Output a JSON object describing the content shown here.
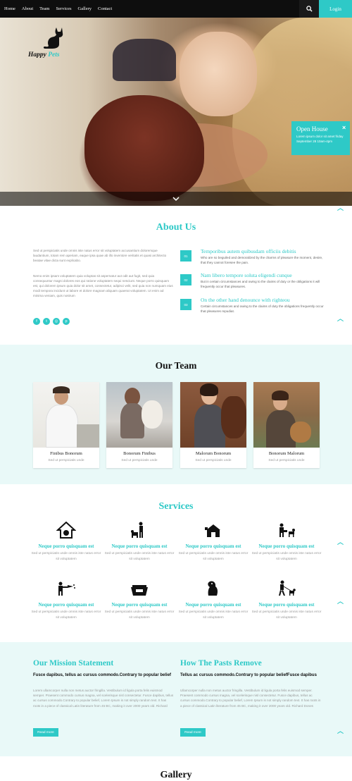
{
  "nav": {
    "items": [
      "Home",
      "About",
      "Team",
      "Services",
      "Gallery",
      "Contact"
    ],
    "search_icon": "search-icon",
    "login_label": "Login"
  },
  "brand": {
    "name_part1": "Happy",
    "name_part2": "Pets"
  },
  "hero": {
    "popup": {
      "title": "Open House",
      "close": "×",
      "text": "Lorem ipsum dolor sit amet friday September 28 10am-4pm"
    }
  },
  "about": {
    "title": "About Us",
    "para1": "Sed ut perspiciatis unde omnis iste natus error sit voluptatem accusantium doloremque laudantium, totam rem aperiam, eaque ipsa quae ab illo inventore veritatis et quasi architecto beatae vitae dicta sunt explicabo.",
    "para2": "Nemo enim ipsam voluptatem quia voluptas sit aspernatur aut odit aut fugit, sed quia consequuntur magni dolores eos qui ratione voluptatem sequi nesciunt. Neque porro quisquam est, qui dolorem ipsum quia dolor sit amet, consectetur, adipisci velit, sed quia non numquam eius modi tempora incidunt ut labore et dolore magnam aliquam quaerat voluptatem. Ut enim ad minima veniam, quis nostrum",
    "features": [
      {
        "num": "01",
        "title": "Temporibus autem quibusdam officiis debitis",
        "text": "Who are so beguiled and demoralized by the charms of pleasure the moment, desire, that they cannot foresee the pain."
      },
      {
        "num": "02",
        "title": "Nam libero tempore soluta eligendi cunque",
        "text": "But in certain circumstances and owing to the claims of duty or the obligations it will frequently occur that pleasures."
      },
      {
        "num": "03",
        "title": "On the other hand denounce with righteou",
        "text": "Certain circumstances and owing to the claims of duty the obligations frequently occur that pleasures repudiat."
      }
    ]
  },
  "team": {
    "title": "Our Team",
    "members": [
      {
        "name": "Finibus Bonorum",
        "subtitle": "Sed ut perspiciatis unde"
      },
      {
        "name": "Bonorum Finibus",
        "subtitle": "Sed ut perspiciatis unde"
      },
      {
        "name": "Malorum Bonorum",
        "subtitle": "Sed ut perspiciatis unde"
      },
      {
        "name": "Bonorum Malorum",
        "subtitle": "Sed ut perspiciatis unde"
      }
    ]
  },
  "services": {
    "title": "Services",
    "items": [
      {
        "icon": "dog-house-icon",
        "title": "Neque porro quisquam est",
        "text": "Sed ut perspiciatis unde omnis iste natus error sit voluptatem"
      },
      {
        "icon": "dog-trainer-icon",
        "title": "Neque porro quisquam est",
        "text": "Sed ut perspiciatis unde omnis iste natus error sit voluptatem"
      },
      {
        "icon": "kennel-icon",
        "title": "Neque porro quisquam est",
        "text": "Sed ut perspiciatis unde omnis iste natus error sit voluptatem"
      },
      {
        "icon": "dog-care-icon",
        "title": "Neque porro quisquam est",
        "text": "Sed ut perspiciatis unde omnis iste natus error sit voluptatem"
      },
      {
        "icon": "dog-grooming-icon",
        "title": "Neque porro quisquam est",
        "text": "Sed ut perspiciatis unde omnis iste natus error sit voluptatem"
      },
      {
        "icon": "pet-bowl-icon",
        "title": "Neque porro quisquam est",
        "text": "Sed ut perspiciatis unde omnis iste natus error sit voluptatem"
      },
      {
        "icon": "cat-dog-icon",
        "title": "Neque porro quisquam est",
        "text": "Sed ut perspiciatis unde omnis iste natus error sit voluptatem"
      },
      {
        "icon": "dog-walking-icon",
        "title": "Neque porro quisquam est",
        "text": "Sed ut perspiciatis unde omnis iste natus error sit voluptatem"
      }
    ]
  },
  "mission": {
    "left": {
      "title": "Our Mission Statement",
      "bold": "Fusce dapibus, tellus ac cursus commodo.Contrary to popular belief",
      "text": "Lorem ullamcorper nulla non metus auctor fringilla. Vestibulum id ligula porta felis euismod semper. Praesent commodo cursus magna, vel scelerisque nisl consectetur. Fusce dapibus, tellus ac cursus commodo.Contrary to popular belief, Lorem Ipsum is not simply random text. It has roots in a piece of classical Latin literature from 45 BC, making it over 2000 years old. Richard",
      "button": "Read more"
    },
    "right": {
      "title": "How The Pasts Remove",
      "bold": "Tellus ac cursus commodo.Contrary to popular beliefFusce dapibus",
      "text": "Ullamcorper nulla non metus auctor fringilla. Vestibulum id ligula porta felis euismod semper. Praesent commodo cursus magna, vel scelerisque nisl consectetur. Fusce dapibus, tellus ac cursus commodo.Contrary to popular belief, Lorem Ipsum is not simply random text. It has roots in a piece of classical Latin literature from 45 BC, making it over 2000 years old. Richard Dones",
      "button": "Read more"
    }
  },
  "gallery": {
    "title": "Gallery"
  },
  "colors": {
    "accent": "#2ec9c7",
    "nav_bg": "#0e0e0e",
    "section_tint": "#e9f9f8"
  }
}
